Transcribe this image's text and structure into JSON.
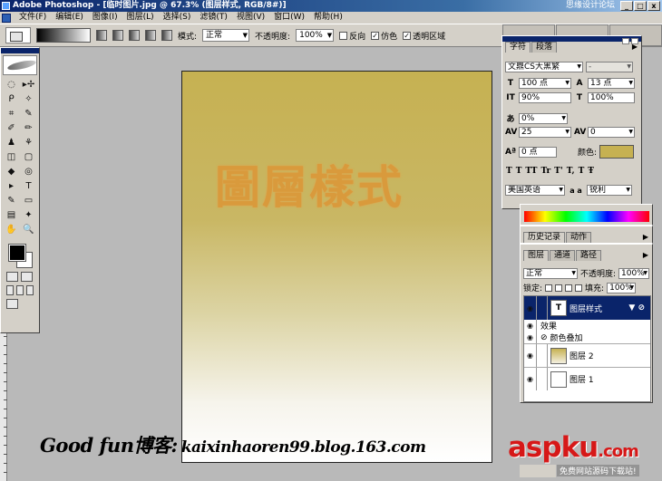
{
  "window": {
    "title": "Adobe Photoshop - [临时图片.jpg @ 67.3% (图层样式, RGB/8#)]",
    "site_text": "思缘设计论坛",
    "controls": [
      "_",
      "□",
      "x"
    ]
  },
  "menu": [
    "文件(F)",
    "编辑(E)",
    "图像(I)",
    "图层(L)",
    "选择(S)",
    "滤镜(T)",
    "视图(V)",
    "窗口(W)",
    "帮助(H)"
  ],
  "options": {
    "mode_label": "模式:",
    "mode_value": "正常",
    "opacity_label": "不透明度:",
    "opacity_value": "100%",
    "reverse_label": "反向",
    "dither_label": "仿色",
    "transparency_label": "透明区域",
    "dither_checked": "✓",
    "transparency_checked": "✓"
  },
  "toolbox": {
    "tools": [
      "◌",
      "▸✢",
      "ᑭ",
      "✧",
      "⌗",
      "✎",
      "✐",
      "✏",
      "♟",
      "⚘",
      "◫",
      "▢",
      "◆",
      "◎",
      "▸",
      "T",
      "✎",
      "▭",
      "▤",
      "✦",
      "✋",
      "🔍"
    ]
  },
  "canvas": {
    "text": "圖層樣式"
  },
  "character_panel": {
    "tabs": [
      "字符",
      "段落"
    ],
    "font_family": "文鼎CS大黑繁",
    "font_style": "-",
    "size": "100 点",
    "leading": "13 点",
    "vscale": "90%",
    "hscale": "100%",
    "tsume": "0%",
    "tracking": "25",
    "kerning": "0",
    "baseline": "0 点",
    "color_label": "颜色:",
    "color": "#c6b152",
    "styles": [
      "T",
      "T",
      "TT",
      "Tr",
      "T'",
      "T,",
      "T",
      "Ŧ"
    ],
    "language": "美国英语",
    "aa_label": "a a",
    "aa_value": "锐利"
  },
  "history_panel": {
    "tabs": [
      "历史记录",
      "动作"
    ]
  },
  "layers_panel": {
    "tabs": [
      "图层",
      "通道",
      "路径"
    ],
    "blend_mode": "正常",
    "opacity_label": "不透明度:",
    "opacity_value": "100%",
    "lock_label": "锁定:",
    "fill_label": "填充:",
    "fill_value": "100%",
    "layers": [
      {
        "name": "图层样式",
        "type": "text",
        "selected": true,
        "thumb": "T"
      },
      {
        "name": "效果",
        "type": "effect-header"
      },
      {
        "name": "颜色叠加",
        "type": "effect"
      },
      {
        "name": "图层 2",
        "type": "raster",
        "thumb_color": "#c6b152"
      },
      {
        "name": "图层 1",
        "type": "raster",
        "thumb_color": "#ffffff"
      }
    ]
  },
  "overlay": {
    "blog_prefix": "Good fun博客:",
    "blog_url": "kaixinhaoren99.blog.163.com",
    "watermark_a": "asp",
    "watermark_b": "ku",
    "watermark_c": ".com",
    "watermark_sub": "免费网站源码下载站!"
  }
}
